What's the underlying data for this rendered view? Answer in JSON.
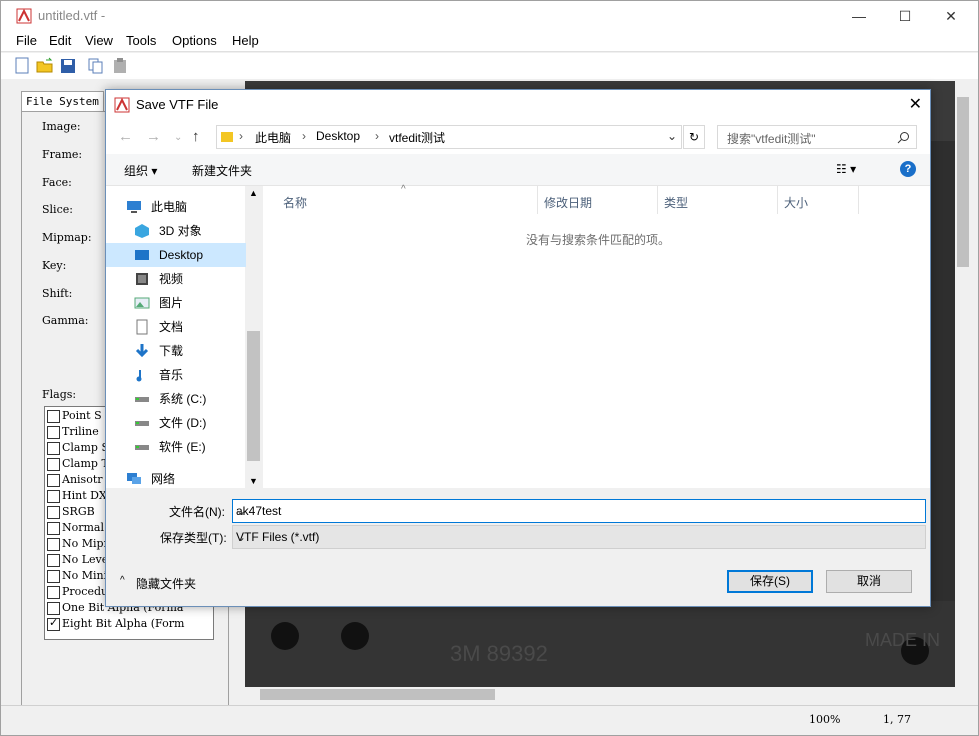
{
  "window": {
    "title": "untitled.vtf -",
    "minimize": "—",
    "maximize": "☐",
    "close": "✕"
  },
  "menu": [
    "File",
    "Edit",
    "View",
    "Tools",
    "Options",
    "Help"
  ],
  "left_panel": {
    "tab": "File System",
    "fields": [
      "Image:",
      "Frame:",
      "Face:",
      "Slice:",
      "Mipmap:",
      "Key:",
      "Shift:",
      "Gamma:"
    ],
    "flags_label": "Flags:",
    "flags": [
      {
        "label": "Point S",
        "checked": false
      },
      {
        "label": "Triline",
        "checked": false
      },
      {
        "label": "Clamp S",
        "checked": false
      },
      {
        "label": "Clamp T",
        "checked": false
      },
      {
        "label": "Anisotr",
        "checked": false
      },
      {
        "label": "Hint DX",
        "checked": false
      },
      {
        "label": "SRGB",
        "checked": false
      },
      {
        "label": "Normal M",
        "checked": false
      },
      {
        "label": "No Mipm",
        "checked": false
      },
      {
        "label": "No Leve",
        "checked": false
      },
      {
        "label": "No Mini",
        "checked": false
      },
      {
        "label": "Procedu",
        "checked": false
      },
      {
        "label": "One Bit Alpha (Forma",
        "checked": false
      },
      {
        "label": "Eight Bit Alpha (Form",
        "checked": true
      }
    ]
  },
  "viewer": {
    "text_bottom": "3M  89392",
    "text_right": "MADE IN"
  },
  "status": {
    "zoom": "100%",
    "coords": "1, 77"
  },
  "dialog": {
    "title": "Save VTF File",
    "close": "✕",
    "nav": {
      "back": "←",
      "forward": "→",
      "up": "↑"
    },
    "breadcrumb": [
      "此电脑",
      "Desktop",
      "vtfedit测试"
    ],
    "refresh": "↻",
    "search_placeholder": "搜索\"vtfedit测试\"",
    "cmd": {
      "organize": "组织 ▾",
      "new_folder": "新建文件夹",
      "view": "☷ ▾",
      "help": "?"
    },
    "nav_items": [
      {
        "label": "此电脑",
        "icon": "computer-icon"
      },
      {
        "label": "3D 对象",
        "icon": "cube-icon"
      },
      {
        "label": "Desktop",
        "icon": "desktop-icon",
        "selected": true
      },
      {
        "label": "视频",
        "icon": "video-icon"
      },
      {
        "label": "图片",
        "icon": "picture-icon"
      },
      {
        "label": "文档",
        "icon": "document-icon"
      },
      {
        "label": "下载",
        "icon": "download-icon"
      },
      {
        "label": "音乐",
        "icon": "music-icon"
      },
      {
        "label": "系统 (C:)",
        "icon": "drive-icon"
      },
      {
        "label": "文件 (D:)",
        "icon": "drive-icon"
      },
      {
        "label": "软件 (E:)",
        "icon": "drive-icon"
      },
      {
        "label": "网络",
        "icon": "network-icon"
      }
    ],
    "columns": [
      "名称",
      "修改日期",
      "类型",
      "大小"
    ],
    "empty_message": "没有与搜索条件匹配的项。",
    "filename_label": "文件名(N):",
    "filename_value": "ak47test",
    "filetype_label": "保存类型(T):",
    "filetype_value": "VTF Files (*.vtf)",
    "hide_folders": "隐藏文件夹",
    "save_button": "保存(S)",
    "cancel_button": "取消"
  }
}
